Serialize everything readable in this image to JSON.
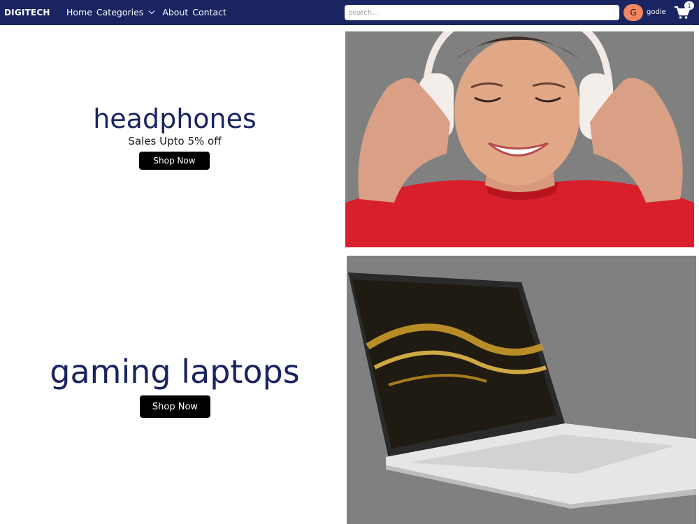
{
  "brand": "DIGITECH",
  "nav": {
    "home": "Home",
    "categories": "Categories",
    "about": "About",
    "contact": "Contact"
  },
  "search": {
    "placeholder": "search...",
    "value": ""
  },
  "user": {
    "initial": "G",
    "name": "godie"
  },
  "cart": {
    "count": "1",
    "icon": "cart-icon"
  },
  "colors": {
    "navbar": "#1a2460",
    "avatar": "#f2875f",
    "title": "#1a2460",
    "button": "#000000",
    "panel_bg": "#808080",
    "sweater": "#d81f2b"
  },
  "promos": [
    {
      "title": "headphones",
      "subtitle": "Sales Upto 5% off",
      "button": "Shop Now",
      "image": "woman-wearing-headphones"
    },
    {
      "title": "gaming laptops",
      "button": "Shop Now",
      "image": "silver-laptop"
    }
  ]
}
